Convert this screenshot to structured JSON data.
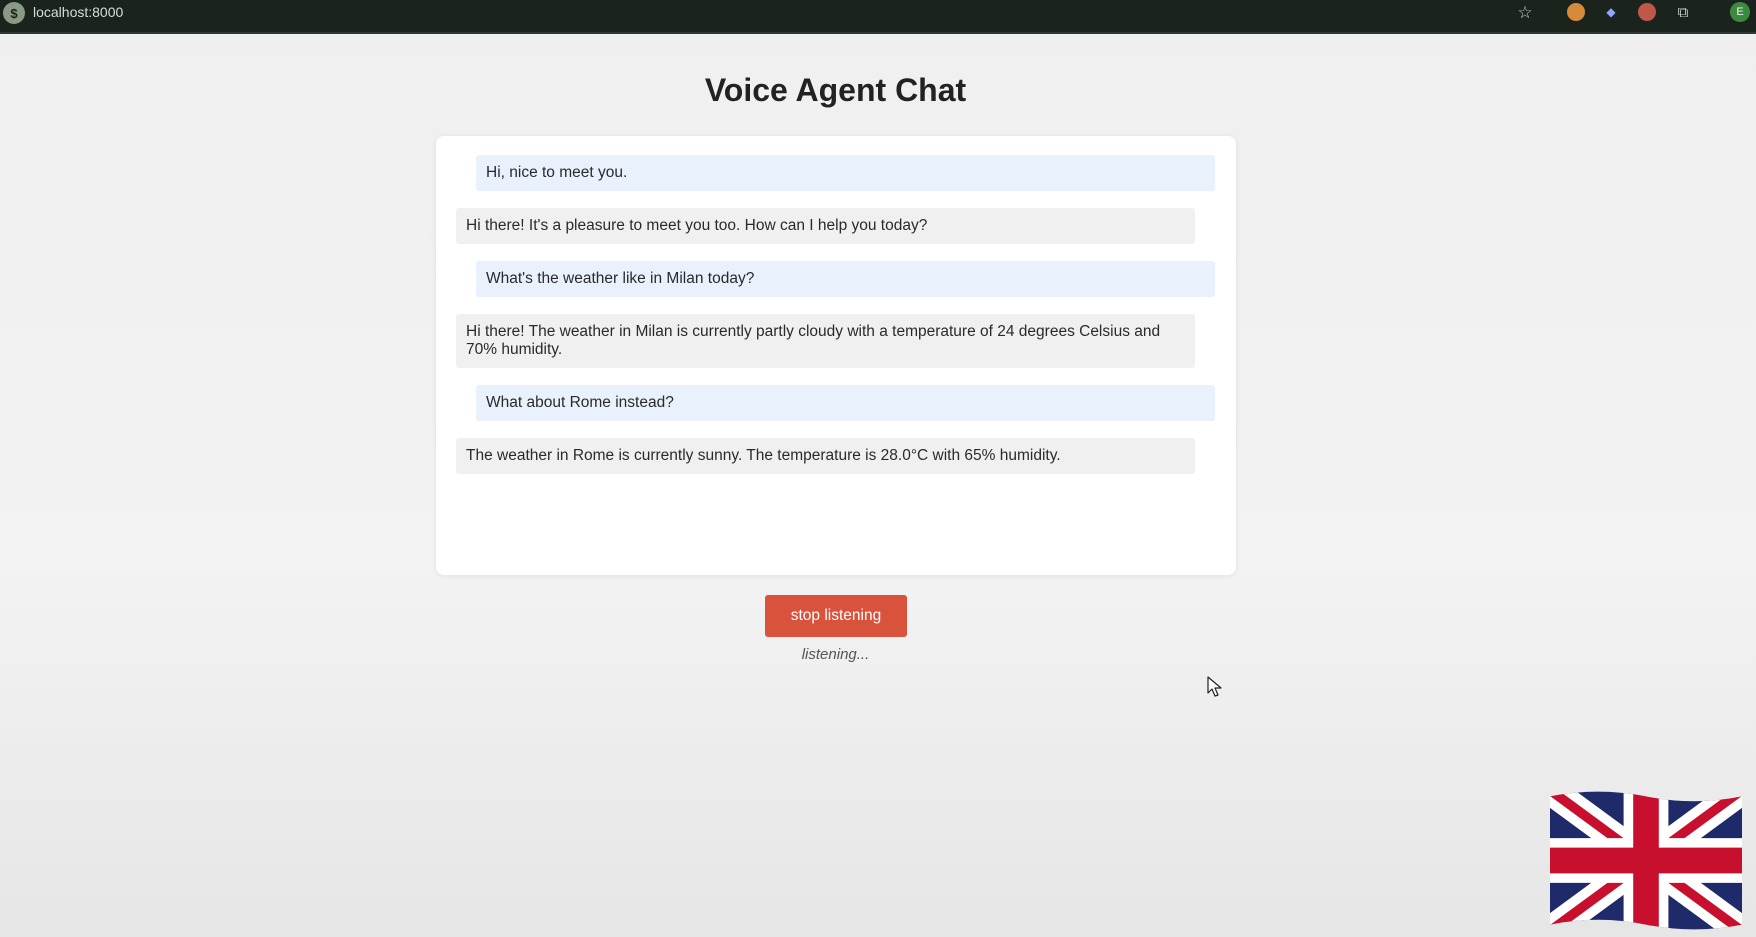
{
  "browser": {
    "url": "localhost:8000",
    "site_icon_glyph": "$",
    "icons": [
      "star-icon",
      "extension-orange-icon",
      "extension-blue-icon",
      "extension-red-icon",
      "puzzle-icon",
      "profile-icon"
    ],
    "profile_initial": "E"
  },
  "page": {
    "title": "Voice Agent Chat"
  },
  "chat": {
    "messages": [
      {
        "role": "user",
        "text": "Hi, nice to meet you."
      },
      {
        "role": "bot",
        "text": "Hi there! It's a pleasure to meet you too. How can I help you today?"
      },
      {
        "role": "user",
        "text": "What's the weather like in Milan today?"
      },
      {
        "role": "bot",
        "text": "Hi there! The weather in Milan is currently partly cloudy with a temperature of 24 degrees Celsius and 70% humidity."
      },
      {
        "role": "user",
        "text": "What about Rome instead?"
      },
      {
        "role": "bot",
        "text": "The weather in Rome is currently sunny. The temperature is 28.0°C with 65% humidity."
      }
    ]
  },
  "controls": {
    "stop_label": "stop listening",
    "status": "listening..."
  },
  "colors": {
    "user_bubble": "#e8f1fc",
    "bot_bubble": "#f0f0f0",
    "button": "#d9533c"
  }
}
